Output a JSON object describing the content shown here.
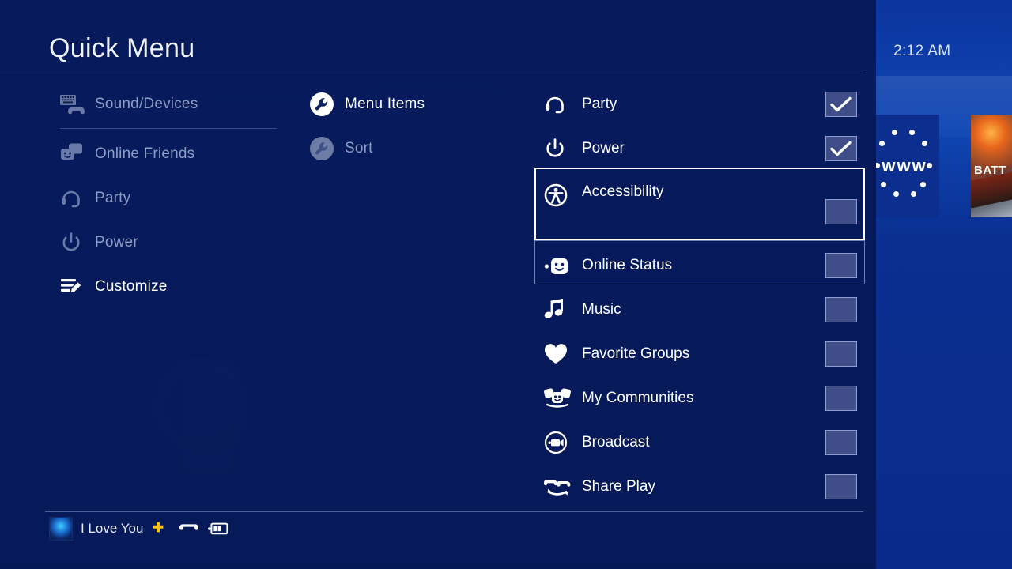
{
  "window": {
    "title": "Quick Menu"
  },
  "clock": {
    "time": "2:12 AM"
  },
  "desktop": {
    "browser_tile": {
      "label": "www",
      "icon": "www-icon"
    },
    "game_tile": {
      "title": "BATT"
    }
  },
  "left_column": {
    "items": [
      {
        "label": "Sound/Devices",
        "icon": "keyboard-controller-icon",
        "state": "dimmed"
      },
      {
        "label": "Online Friends",
        "icon": "friends-icon",
        "state": "dimmed"
      },
      {
        "label": "Party",
        "icon": "headset-icon",
        "state": "dimmed"
      },
      {
        "label": "Power",
        "icon": "power-icon",
        "state": "dimmed"
      },
      {
        "label": "Customize",
        "icon": "customize-pencil-icon",
        "state": "active"
      }
    ]
  },
  "middle_column": {
    "items": [
      {
        "label": "Menu Items",
        "icon": "wrench-icon",
        "state": "active"
      },
      {
        "label": "Sort",
        "icon": "wrench-icon",
        "state": "dimmed"
      }
    ]
  },
  "right_column": {
    "items": [
      {
        "label": "Party",
        "icon": "headset-icon",
        "checked": true
      },
      {
        "label": "Power",
        "icon": "power-icon",
        "checked": true
      },
      {
        "label": "Accessibility",
        "icon": "accessibility-icon",
        "checked": false,
        "selected": true
      },
      {
        "label": "Online Status",
        "icon": "online-status-smiley-icon",
        "checked": false,
        "drop_target": true
      },
      {
        "label": "Music",
        "icon": "music-note-icon",
        "checked": false
      },
      {
        "label": "Favorite Groups",
        "icon": "heart-icon",
        "checked": false
      },
      {
        "label": "My Communities",
        "icon": "communities-icon",
        "checked": false
      },
      {
        "label": "Broadcast",
        "icon": "broadcast-camera-icon",
        "checked": false
      },
      {
        "label": "Share Play",
        "icon": "share-play-icon",
        "checked": false
      }
    ]
  },
  "user_bar": {
    "username": "I Love You",
    "plus_icon": "ps-plus-icon",
    "controller_icon": "controller-icon",
    "battery_icon": "battery-icon"
  },
  "colors": {
    "overlay": "#061854",
    "desktop_blue": "#0a2a8c",
    "checkbox_fill": "#3f4d88",
    "checkbox_border": "#8fa0cf",
    "selection_border": "#ffffff",
    "dim_text": "#8e9dc4",
    "active_text": "#ffffff",
    "plus_yellow": "#f2c318"
  }
}
